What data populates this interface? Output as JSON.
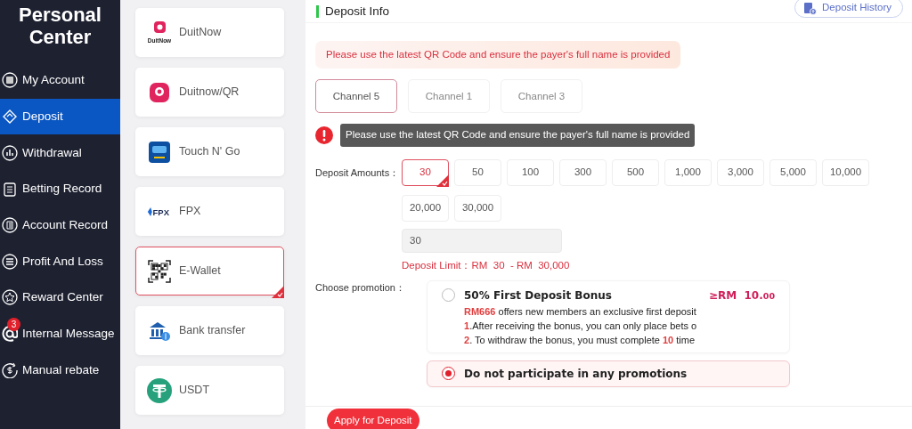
{
  "sidebar": {
    "title": "Personal Center",
    "items": [
      {
        "label": "My Account",
        "selected": false
      },
      {
        "label": "Deposit",
        "selected": true
      },
      {
        "label": "Withdrawal",
        "selected": false
      },
      {
        "label": "Betting Record",
        "selected": false
      },
      {
        "label": "Account Record",
        "selected": false
      },
      {
        "label": "Profit And Loss",
        "selected": false
      },
      {
        "label": "Reward Center",
        "selected": false
      },
      {
        "label": "Internal Message",
        "selected": false,
        "badge": "3"
      },
      {
        "label": "Manual rebate",
        "selected": false
      }
    ]
  },
  "methods": [
    {
      "label": "DuitNow",
      "logo_text": "DuitNow",
      "selected": false
    },
    {
      "label": "Duitnow/QR",
      "selected": false
    },
    {
      "label": "Touch N' Go",
      "selected": false
    },
    {
      "label": "FPX",
      "logo_text": "FPX",
      "selected": false
    },
    {
      "label": "E-Wallet",
      "selected": true
    },
    {
      "label": "Bank transfer",
      "selected": false
    },
    {
      "label": "USDT",
      "selected": false
    }
  ],
  "header": {
    "title": "Deposit Info",
    "history_button": "Deposit History"
  },
  "notice": "Please use the latest QR Code and ensure the payer's full name is provided",
  "channels": [
    {
      "label": "Channel 5",
      "selected": true
    },
    {
      "label": "Channel 1",
      "selected": false
    },
    {
      "label": "Channel 3",
      "selected": false
    }
  ],
  "tooltip": "Please use the latest QR Code and ensure the payer's full name is provided",
  "amounts_label": "Deposit Amounts：",
  "amounts": [
    {
      "label": "30",
      "selected": true
    },
    {
      "label": "50",
      "selected": false
    },
    {
      "label": "100",
      "selected": false
    },
    {
      "label": "300",
      "selected": false
    },
    {
      "label": "500",
      "selected": false
    },
    {
      "label": "1,000",
      "selected": false
    },
    {
      "label": "3,000",
      "selected": false
    },
    {
      "label": "5,000",
      "selected": false
    },
    {
      "label": "10,000",
      "selected": false
    },
    {
      "label": "20,000",
      "selected": false
    },
    {
      "label": "30,000",
      "selected": false
    }
  ],
  "amount_value": "30",
  "deposit_limit": "Deposit Limit：RM  30  - RM  30,000",
  "promotion_label": "Choose promotion：",
  "promotions": [
    {
      "title": "50% First Deposit Bonus",
      "amount": "≥RM  10.",
      "amount_decimals": "00",
      "selected": false,
      "lines": [
        {
          "mark": "RM666",
          "text": " offers new members an exclusive first deposit"
        },
        {
          "mark": "1",
          "text": ".After receiving the bonus, you can only place bets o"
        },
        {
          "mark": "2",
          "text": ". To withdraw the bonus, you must complete ",
          "mark2": "10",
          "text2": " time"
        }
      ]
    },
    {
      "title": "Do not participate in any promotions",
      "selected": true
    }
  ],
  "submit_button": "Apply for Deposit"
}
